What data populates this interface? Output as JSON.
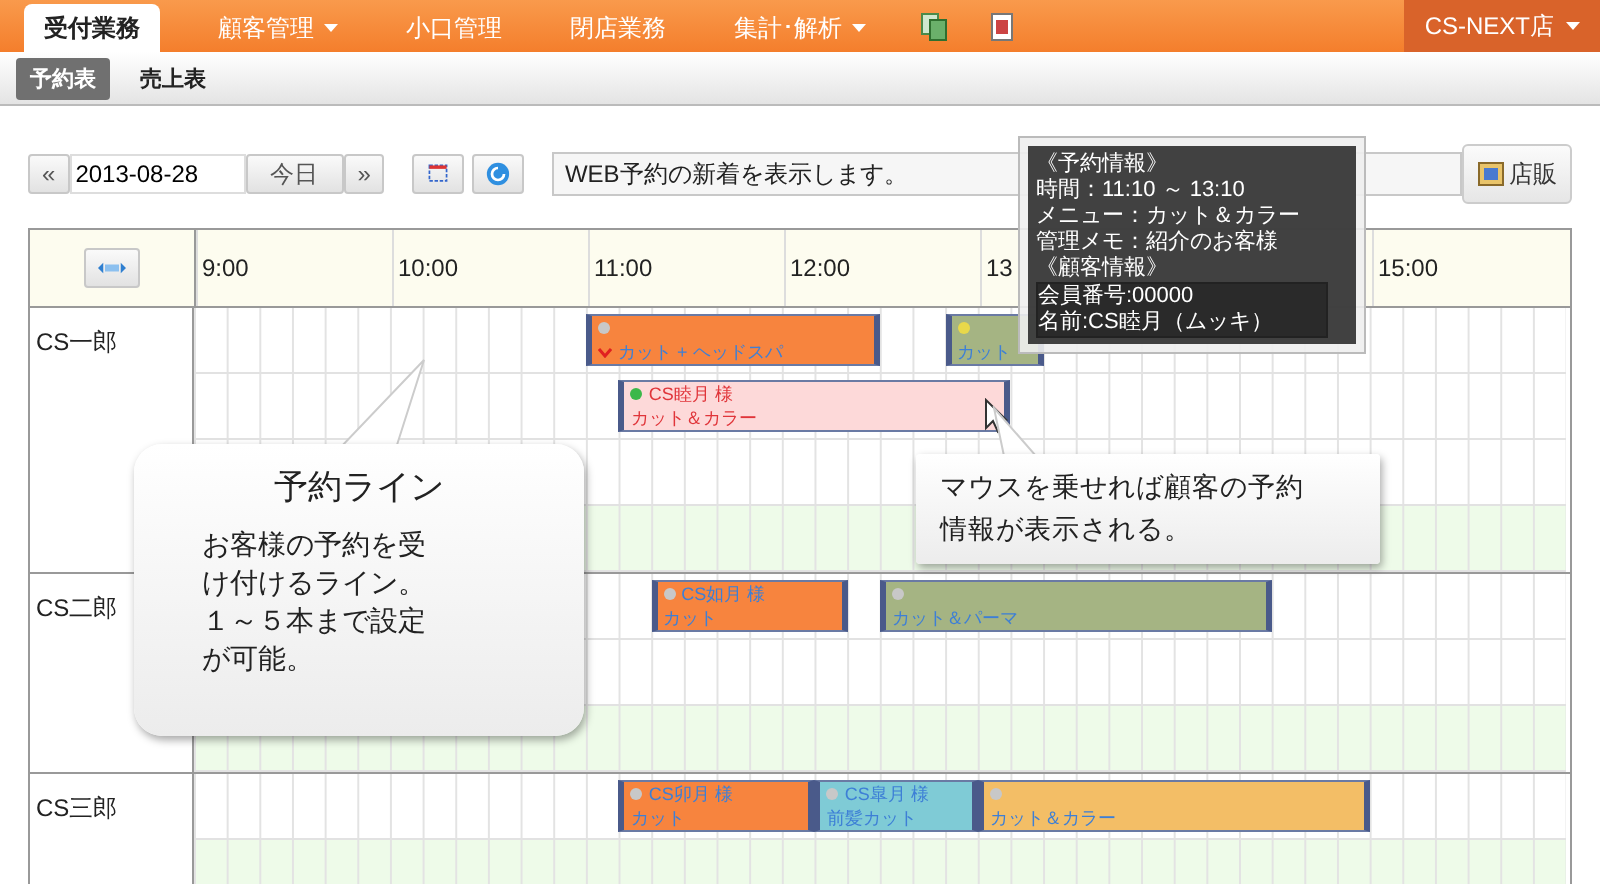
{
  "nav": {
    "tabs": [
      {
        "label": "受付業務",
        "selected": true,
        "dropdown": false
      },
      {
        "label": "顧客管理",
        "selected": false,
        "dropdown": true
      },
      {
        "label": "小口管理",
        "selected": false,
        "dropdown": false
      },
      {
        "label": "閉店業務",
        "selected": false,
        "dropdown": false
      },
      {
        "label": "集計･解析",
        "selected": false,
        "dropdown": true
      }
    ],
    "store": {
      "label": "CS-NEXT店",
      "dropdown": true
    }
  },
  "subtabs": [
    {
      "label": "予約表",
      "selected": true
    },
    {
      "label": "売上表",
      "selected": false
    }
  ],
  "toolbar": {
    "prev": "«",
    "date": "2013-08-28",
    "today": "今日",
    "next": "»",
    "notice": "WEB予約の新着を表示します。",
    "shop_button": "店販"
  },
  "schedule": {
    "time_labels": [
      "9:00",
      "10:00",
      "11:00",
      "12:00",
      "13",
      "15:00"
    ],
    "staff": [
      {
        "name": "CS一郎",
        "lanes": [
          {
            "shaded": false,
            "bookings": [
              {
                "color": "#f7843e",
                "dot": {
                  "color": "#c8c8c8"
                },
                "menu": "カット + ヘッドスパ",
                "flagged": true,
                "selected": false
              },
              {
                "color": "#a5b483",
                "dot": {
                  "color": "#e8d84a"
                },
                "menu": "カット",
                "flagged": false,
                "selected": false
              }
            ]
          },
          {
            "shaded": false,
            "bookings": [
              {
                "color": "#fdd9d9",
                "dot": {
                  "color": "#3cb84a"
                },
                "customer": "CS睦月 様",
                "menu": "カット＆カラー",
                "flagged": false,
                "selected": true
              }
            ]
          },
          {
            "shaded": false
          },
          {
            "shaded": true
          }
        ]
      },
      {
        "name": "CS二郎",
        "lanes": [
          {
            "shaded": false,
            "bookings": [
              {
                "color": "#f7843e",
                "dot": {
                  "color": "#c8c8c8"
                },
                "customer": "CS如月 様",
                "menu": "カット",
                "flagged": false,
                "selected": false
              },
              {
                "color": "#a5b483",
                "dot": {
                  "color": "#c8c8c8"
                },
                "menu": "カット＆パーマ",
                "flagged": false,
                "selected": false
              }
            ]
          },
          {
            "shaded": false
          },
          {
            "shaded": true
          }
        ]
      },
      {
        "name": "CS三郎",
        "lanes": [
          {
            "shaded": false,
            "bookings": [
              {
                "color": "#f7843e",
                "dot": {
                  "color": "#c8c8c8"
                },
                "customer": "CS卯月 様",
                "menu": "カット",
                "flagged": false,
                "selected": false
              },
              {
                "color": "#7fcbd6",
                "dot": {
                  "color": "#c8c8c8"
                },
                "customer": "CS皐月 様",
                "menu": "前髪カット",
                "flagged": false,
                "selected": false
              },
              {
                "color": "#f3be66",
                "dot": {
                  "color": "#c8c8c8"
                },
                "menu": "カット＆カラー",
                "flagged": false,
                "selected": false
              }
            ]
          },
          {
            "shaded": true
          }
        ]
      }
    ]
  },
  "tooltip": {
    "sections": [
      {
        "heading": "《予約情報》",
        "boxed": false,
        "lines": [
          "時間：11:10 ～ 13:10",
          "メニュー：カット＆カラー",
          "管理メモ：紹介のお客様"
        ]
      },
      {
        "heading": "《顧客情報》",
        "boxed": true,
        "lines": [
          "会員番号:00000",
          "名前:CS睦月（ムッキ）"
        ]
      }
    ]
  },
  "callouts": [
    {
      "kind": "titled",
      "title": "予約ライン",
      "lines": [
        "お客様の予約を受け付けるライン。",
        "１～５本まで設定が可能。"
      ]
    },
    {
      "kind": "plain",
      "lines": [
        "マウスを乗せれば顧客の予約情報が表示される。"
      ]
    }
  ]
}
